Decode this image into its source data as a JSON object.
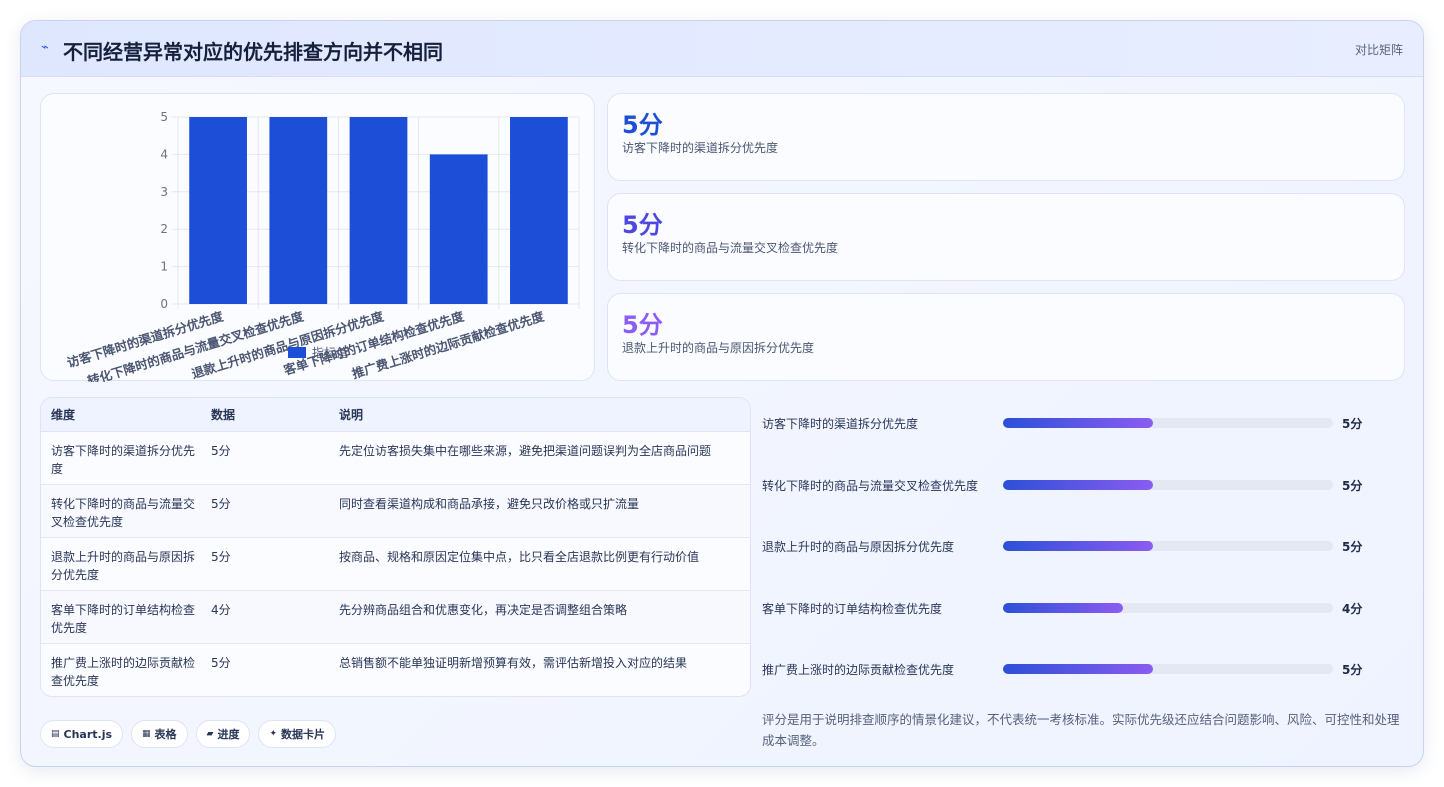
{
  "header": {
    "icon": "lightning-icon",
    "title": "不同经营异常对应的优先排查方向并不相同",
    "right_label": "对比矩阵"
  },
  "chart_data": {
    "type": "bar",
    "categories": [
      "访客下降时的渠道拆分优先度",
      "转化下降时的商品与流量交叉检查优先度",
      "退款上升时的商品与原因拆分优先度",
      "客单下降时的订单结构检查优先度",
      "推广费上涨时的边际贡献检查优先度"
    ],
    "series": [
      {
        "name": "指标值",
        "values": [
          5,
          5,
          5,
          4,
          5
        ]
      }
    ],
    "ylim": [
      0,
      5
    ],
    "yticks": [
      "0",
      "1",
      "2",
      "3",
      "4",
      "5"
    ],
    "legend_position": "bottom",
    "grid": true,
    "color": "#1d4ed8"
  },
  "stats": [
    {
      "value": "5分",
      "label": "访客下降时的渠道拆分优先度",
      "color": "#1d4ed8"
    },
    {
      "value": "5分",
      "label": "转化下降时的商品与流量交叉检查优先度",
      "color": "#4f46e5"
    },
    {
      "value": "5分",
      "label": "退款上升时的商品与原因拆分优先度",
      "color": "#8b5cf6"
    }
  ],
  "table": {
    "headers": [
      "维度",
      "数据",
      "说明"
    ],
    "rows": [
      [
        "访客下降时的渠道拆分优先度",
        "5分",
        "先定位访客损失集中在哪些来源，避免把渠道问题误判为全店商品问题"
      ],
      [
        "转化下降时的商品与流量交叉检查优先度",
        "5分",
        "同时查看渠道构成和商品承接，避免只改价格或只扩流量"
      ],
      [
        "退款上升时的商品与原因拆分优先度",
        "5分",
        "按商品、规格和原因定位集中点，比只看全店退款比例更有行动价值"
      ],
      [
        "客单下降时的订单结构检查优先度",
        "4分",
        "先分辨商品组合和优惠变化，再决定是否调整组合策略"
      ],
      [
        "推广费上涨时的边际贡献检查优先度",
        "5分",
        "总销售额不能单独证明新增预算有效，需评估新增投入对应的结果"
      ]
    ]
  },
  "progress": [
    {
      "label": "访客下降时的渠道拆分优先度",
      "value_text": "5分",
      "fraction": 0.4545
    },
    {
      "label": "转化下降时的商品与流量交叉检查优先度",
      "value_text": "5分",
      "fraction": 0.4545
    },
    {
      "label": "退款上升时的商品与原因拆分优先度",
      "value_text": "5分",
      "fraction": 0.4545
    },
    {
      "label": "客单下降时的订单结构检查优先度",
      "value_text": "4分",
      "fraction": 0.3636
    },
    {
      "label": "推广费上涨时的边际贡献检查优先度",
      "value_text": "5分",
      "fraction": 0.4545
    }
  ],
  "note": "评分是用于说明排查顺序的情景化建议，不代表统一考核标准。实际优先级还应结合问题影响、风险、可控性和处理成本调整。",
  "tags": [
    {
      "icon": "chart-icon",
      "glyph": "▤",
      "label": "Chart.js"
    },
    {
      "icon": "table-icon",
      "glyph": "▦",
      "label": "表格"
    },
    {
      "icon": "folder-icon",
      "glyph": "▰",
      "label": "进度"
    },
    {
      "icon": "sparkle-icon",
      "glyph": "✦",
      "label": "数据卡片"
    }
  ]
}
